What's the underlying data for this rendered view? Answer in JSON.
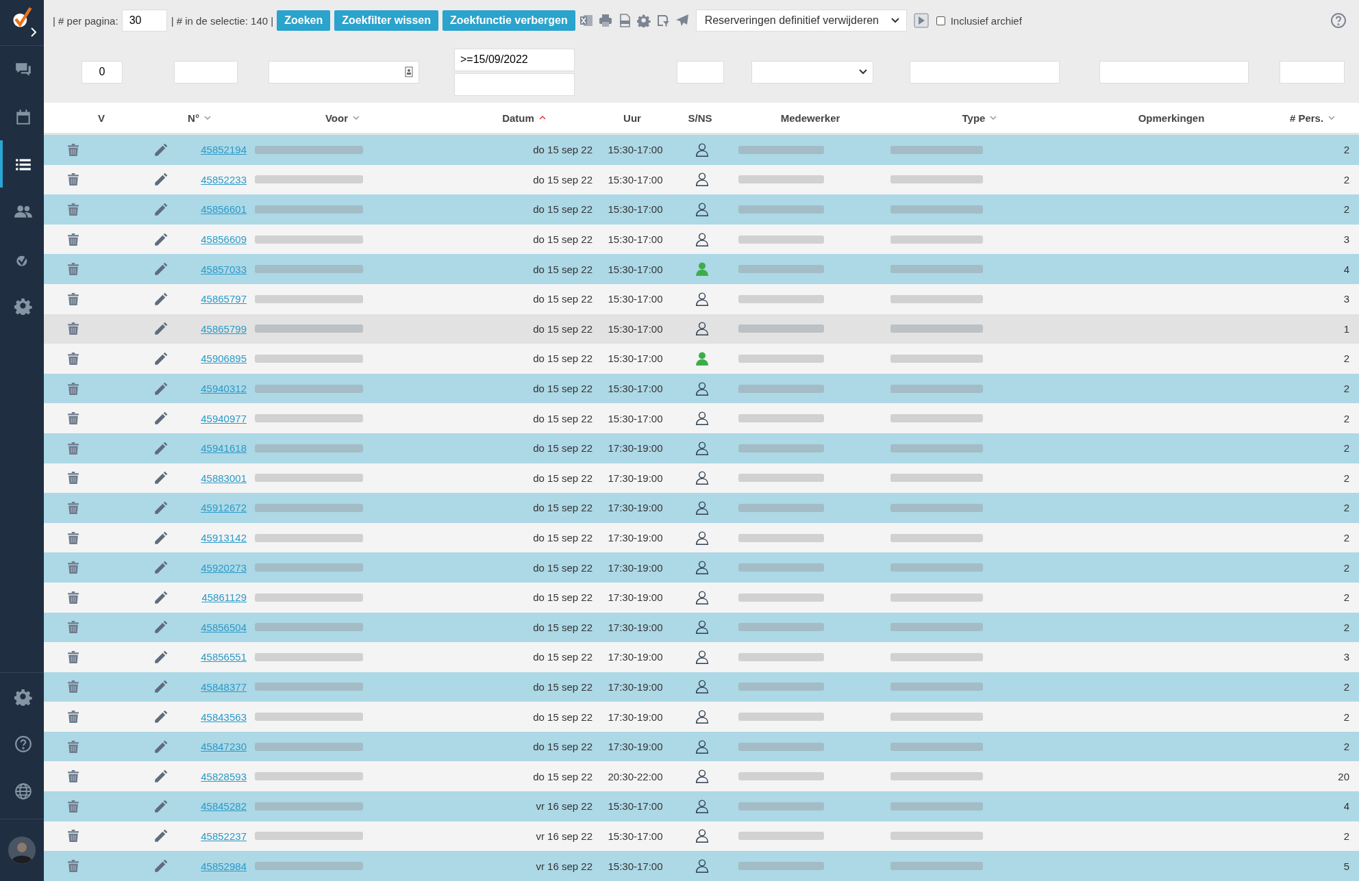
{
  "sidebar": {
    "items": [
      {
        "kind": "chat",
        "selected": false
      },
      {
        "kind": "calendar",
        "selected": false
      },
      {
        "kind": "list",
        "selected": true
      },
      {
        "kind": "people",
        "selected": false
      },
      {
        "kind": "check",
        "selected": false
      },
      {
        "kind": "gear",
        "selected": false
      }
    ],
    "bottom_items": [
      {
        "kind": "gear"
      },
      {
        "kind": "help"
      },
      {
        "kind": "globe"
      }
    ]
  },
  "toolbar": {
    "per_page_label": "| # per pagina:",
    "per_page_value": "30",
    "selection_label": "| # in de selectie: 140 |",
    "buttons": [
      "Zoeken",
      "Zoekfilter wissen",
      "Zoekfunctie verbergen"
    ],
    "action_select": "Reserveringen definitief verwijderen",
    "include_archive": {
      "label": "Inclusief archief",
      "checked": false
    }
  },
  "filters": [
    {
      "kind": "input",
      "value": "0"
    },
    {
      "kind": "input"
    },
    {
      "kind": "input-icon"
    },
    {
      "kind": "date-range",
      "value": ">=15/09/2022"
    },
    {
      "kind": "input"
    },
    {
      "kind": "select"
    },
    {
      "kind": "input"
    },
    {
      "kind": "input"
    },
    {
      "kind": "input"
    }
  ],
  "columns": [
    {
      "label": "V",
      "sortable": false,
      "sorted": false
    },
    {
      "label": "N°",
      "sortable": true,
      "sorted": false
    },
    {
      "label": "Voor",
      "sortable": true,
      "sorted": false
    },
    {
      "label": "Datum",
      "sortable": true,
      "sorted": true
    },
    {
      "label": "Uur",
      "sortable": false,
      "sorted": false
    },
    {
      "label": "S/NS",
      "sortable": false,
      "sorted": false
    },
    {
      "label": "Medewerker",
      "sortable": false,
      "sorted": false
    },
    {
      "label": "Type",
      "sortable": true,
      "sorted": false
    },
    {
      "label": "Opmerkingen",
      "sortable": false,
      "sorted": false
    },
    {
      "label": "# Pers.",
      "sortable": true,
      "sorted": false
    }
  ],
  "rows": [
    {
      "number": "45852194",
      "date": "do 15 sep 22",
      "time": "15:30-17:00",
      "present": false,
      "persons": "2",
      "hovered": false
    },
    {
      "number": "45852233",
      "date": "do 15 sep 22",
      "time": "15:30-17:00",
      "present": false,
      "persons": "2",
      "hovered": false
    },
    {
      "number": "45856601",
      "date": "do 15 sep 22",
      "time": "15:30-17:00",
      "present": false,
      "persons": "2",
      "hovered": false
    },
    {
      "number": "45856609",
      "date": "do 15 sep 22",
      "time": "15:30-17:00",
      "present": false,
      "persons": "3",
      "hovered": false
    },
    {
      "number": "45857033",
      "date": "do 15 sep 22",
      "time": "15:30-17:00",
      "present": true,
      "persons": "4",
      "hovered": false
    },
    {
      "number": "45865797",
      "date": "do 15 sep 22",
      "time": "15:30-17:00",
      "present": false,
      "persons": "3",
      "hovered": false
    },
    {
      "number": "45865799",
      "date": "do 15 sep 22",
      "time": "15:30-17:00",
      "present": false,
      "persons": "1",
      "hovered": true
    },
    {
      "number": "45906895",
      "date": "do 15 sep 22",
      "time": "15:30-17:00",
      "present": true,
      "persons": "2",
      "hovered": false
    },
    {
      "number": "45940312",
      "date": "do 15 sep 22",
      "time": "15:30-17:00",
      "present": false,
      "persons": "2",
      "hovered": false
    },
    {
      "number": "45940977",
      "date": "do 15 sep 22",
      "time": "15:30-17:00",
      "present": false,
      "persons": "2",
      "hovered": false
    },
    {
      "number": "45941618",
      "date": "do 15 sep 22",
      "time": "17:30-19:00",
      "present": false,
      "persons": "2",
      "hovered": false
    },
    {
      "number": "45883001",
      "date": "do 15 sep 22",
      "time": "17:30-19:00",
      "present": false,
      "persons": "2",
      "hovered": false
    },
    {
      "number": "45912672",
      "date": "do 15 sep 22",
      "time": "17:30-19:00",
      "present": false,
      "persons": "2",
      "hovered": false
    },
    {
      "number": "45913142",
      "date": "do 15 sep 22",
      "time": "17:30-19:00",
      "present": false,
      "persons": "2",
      "hovered": false
    },
    {
      "number": "45920273",
      "date": "do 15 sep 22",
      "time": "17:30-19:00",
      "present": false,
      "persons": "2",
      "hovered": false
    },
    {
      "number": "45861129",
      "date": "do 15 sep 22",
      "time": "17:30-19:00",
      "present": false,
      "persons": "2",
      "hovered": false
    },
    {
      "number": "45856504",
      "date": "do 15 sep 22",
      "time": "17:30-19:00",
      "present": false,
      "persons": "2",
      "hovered": false
    },
    {
      "number": "45856551",
      "date": "do 15 sep 22",
      "time": "17:30-19:00",
      "present": false,
      "persons": "3",
      "hovered": false
    },
    {
      "number": "45848377",
      "date": "do 15 sep 22",
      "time": "17:30-19:00",
      "present": false,
      "persons": "2",
      "hovered": false
    },
    {
      "number": "45843563",
      "date": "do 15 sep 22",
      "time": "17:30-19:00",
      "present": false,
      "persons": "2",
      "hovered": false
    },
    {
      "number": "45847230",
      "date": "do 15 sep 22",
      "time": "17:30-19:00",
      "present": false,
      "persons": "2",
      "hovered": false
    },
    {
      "number": "45828593",
      "date": "do 15 sep 22",
      "time": "20:30-22:00",
      "present": false,
      "persons": "20",
      "hovered": false
    },
    {
      "number": "45845282",
      "date": "vr 16 sep 22",
      "time": "15:30-17:00",
      "present": false,
      "persons": "4",
      "hovered": false
    },
    {
      "number": "45852237",
      "date": "vr 16 sep 22",
      "time": "15:30-17:00",
      "present": false,
      "persons": "2",
      "hovered": false
    },
    {
      "number": "45852984",
      "date": "vr 16 sep 22",
      "time": "15:30-17:00",
      "present": false,
      "persons": "5",
      "hovered": false
    }
  ]
}
